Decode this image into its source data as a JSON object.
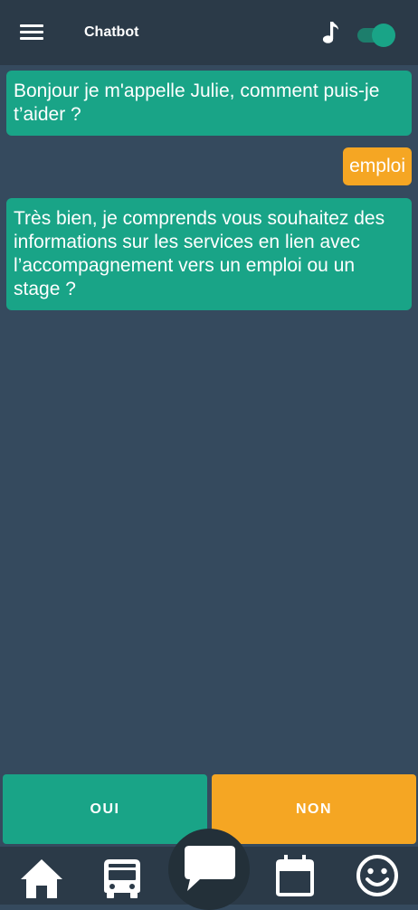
{
  "header": {
    "title": "Chatbot",
    "menu_icon": "hamburger-menu-icon",
    "music_icon": "music-note-icon",
    "sound_toggle_on": true
  },
  "messages": [
    {
      "sender": "bot",
      "text": "Bonjour je m'appelle Julie, comment puis-je t’aider ?"
    },
    {
      "sender": "user",
      "text": "emploi"
    },
    {
      "sender": "bot",
      "text": "Très bien, je comprends vous souhaitez des informations sur les services en lien avec l’accompagnement vers un emploi ou un stage ?"
    }
  ],
  "answers": {
    "yes_label": "OUI",
    "no_label": "NON"
  },
  "nav": {
    "items": [
      "home-icon",
      "bus-icon",
      "chat-icon",
      "calendar-icon",
      "smiley-icon"
    ],
    "active": "chat-icon"
  },
  "colors": {
    "background": "#354a5e",
    "header": "#2b3a48",
    "bot_bubble": "#19a487",
    "user_bubble": "#f5a623",
    "text": "#ffffff"
  }
}
